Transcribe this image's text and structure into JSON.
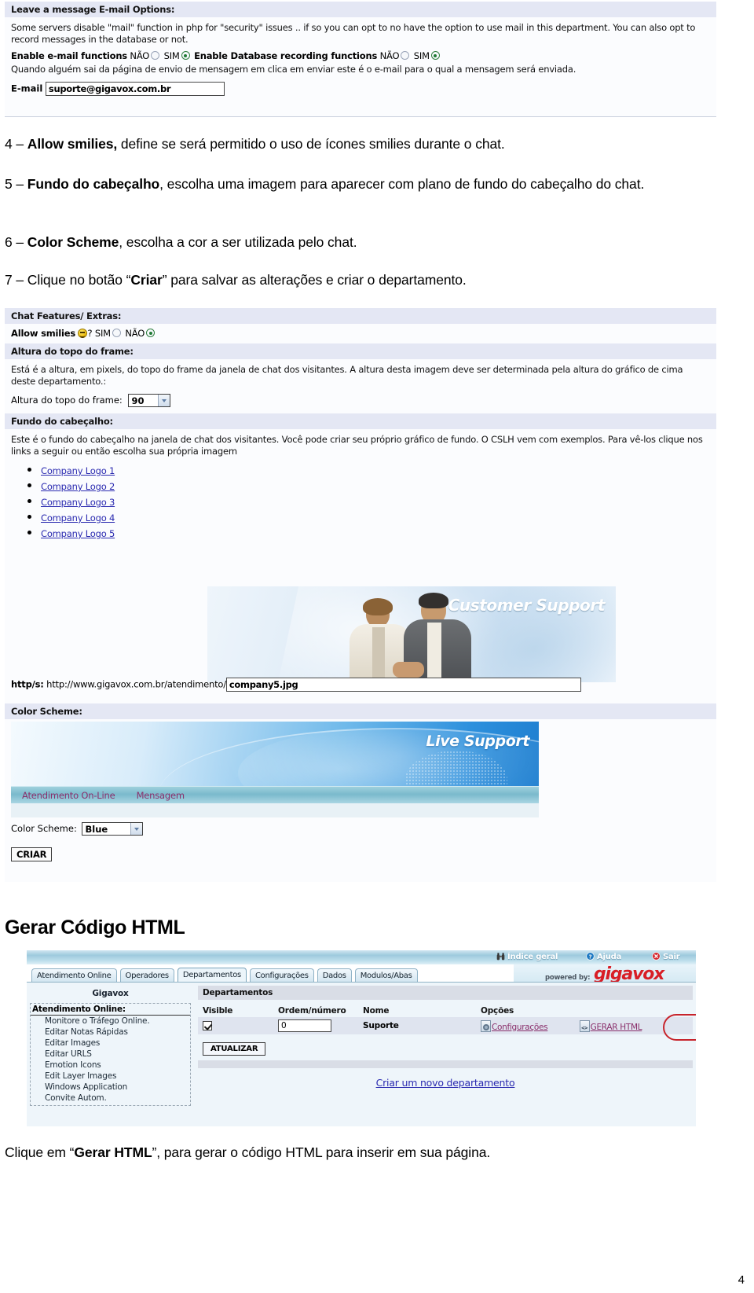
{
  "screenshot_email": {
    "header": "Leave a message E-mail Options:",
    "description": "Some servers disable \"mail\" function in php for \"security\" issues .. if so you can opt to no have the option to use mail in this department. You can also opt to record messages in the database or not.",
    "email_functions_label": "Enable e-mail functions",
    "db_functions_label": "Enable Database recording functions",
    "option_no": "NÃO",
    "option_yes": "SIM",
    "email_functions_selected": "SIM",
    "db_functions_selected": "SIM",
    "note": "Quando alguém sai da página de envio de mensagem em clica em enviar este é o e-mail para o qual a mensagem será enviada.",
    "email_label": "E-mail",
    "email_value": "suporte@gigavox.com.br"
  },
  "body_items": [
    {
      "number": "4 – ",
      "bold": "Allow smilies,",
      "rest": " define se será permitido o uso de ícones smilies durante o chat."
    },
    {
      "number": "5 – ",
      "bold": "Fundo do cabeçalho",
      "rest": ", escolha uma imagem para aparecer com plano de fundo do cabeçalho do chat."
    },
    {
      "number": "6 – ",
      "bold": "Color Scheme",
      "rest": ", escolha a cor a ser utilizada pelo chat."
    },
    {
      "number": "7 – ",
      "bold": "",
      "rest": "Clique no botão “Criar” para salvar as alterações e criar o departamento."
    }
  ],
  "body_item7": {
    "prefix": "7 – Clique no botão “",
    "bold": "Criar",
    "suffix": "” para salvar as alterações e criar o departamento."
  },
  "screenshot_chat": {
    "features_header": "Chat Features/ Extras:",
    "allow_smilies_label": "Allow smilies",
    "allow_smilies_q": "?",
    "option_yes": "SIM",
    "option_no": "NÃO",
    "allow_smilies_selected": "NÃO",
    "frame_header": "Altura do topo do frame:",
    "frame_description": "Está é a altura, em pixels, do topo do frame da janela de chat dos visitantes. A altura desta imagem deve ser determinada pela altura do gráfico de cima deste departamento.:",
    "frame_field_label": "Altura do topo do frame:",
    "frame_field_value": "90",
    "fundo_header": "Fundo do cabeçalho:",
    "fundo_description": "Este é o fundo do cabeçalho na janela de chat dos visitantes. Você pode criar seu próprio gráfico de fundo. O CSLH vem com exemplos. Para vê-los clique nos links a seguir ou então escolha sua própria imagem",
    "logo_links": [
      "Company Logo 1",
      "Company Logo 2",
      "Company Logo 3",
      "Company Logo 4",
      "Company Logo 5"
    ],
    "banner_caption": "Customer Support",
    "url_label": "http/s:",
    "url_prefix": "http://www.gigavox.com.br/atendimento/",
    "url_value": "company5.jpg",
    "color_scheme_header": "Color Scheme:",
    "preview_caption": "Live Support",
    "preview_nav": [
      "Atendimento On-Line",
      "Mensagem"
    ],
    "color_scheme_label": "Color Scheme:",
    "color_scheme_value": "Blue",
    "create_button": "CRIAR"
  },
  "section_heading": "Gerar Código HTML",
  "admin": {
    "topbar": [
      {
        "label": "Índice geral",
        "icon": "binoculars-icon"
      },
      {
        "label": "Ajuda",
        "icon": "help-icon"
      },
      {
        "label": "Sair",
        "icon": "exit-icon"
      }
    ],
    "powered_by": "powered by:",
    "logo_text": "gigavox",
    "tabs": [
      {
        "label": "Atendimento Online",
        "active": false
      },
      {
        "label": "Operadores",
        "active": false
      },
      {
        "label": "Departamentos",
        "active": true
      },
      {
        "label": "Configurações",
        "active": false
      },
      {
        "label": "Dados",
        "active": false
      },
      {
        "label": "Modulos/Abas",
        "active": false
      }
    ],
    "sidebar_title": "Gigavox",
    "sidebar_header": "Atendimento Online:",
    "sidebar_items": [
      "Monitore o Tráfego Online.",
      "Editar Notas Rápidas",
      "Editar Images",
      "Editar URLS",
      "Emotion Icons",
      "Edit Layer Images",
      "Windows Application",
      "Convite Autom."
    ],
    "panel_title": "Departamentos",
    "table_headers": [
      "Visible",
      "Ordem/número",
      "Nome",
      "Opções"
    ],
    "row": {
      "visible_checked": true,
      "ordem": "0",
      "nome": "Suporte",
      "option_config": "Configurações",
      "option_gerar": "GERAR HTML"
    },
    "update_button": "ATUALIZAR",
    "new_department_link": "Criar um novo departamento"
  },
  "closing": {
    "prefix": "Clique em “",
    "bold": "Gerar HTML",
    "suffix": "”, para gerar o código HTML para inserir em sua página."
  },
  "page_number": "4",
  "colors": {
    "link_blue": "#2a2ab0",
    "magenta_link": "#8a2f6b",
    "brand_red": "#d81e26",
    "bar_lavender": "#e4e7f4",
    "accent_blue": "#2d90dd"
  }
}
